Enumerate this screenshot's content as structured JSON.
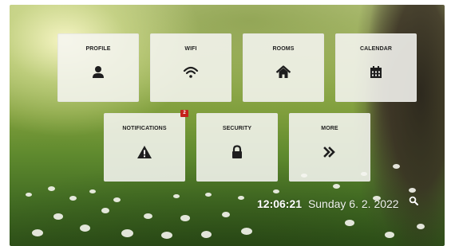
{
  "tiles": {
    "profile": {
      "label": "PROFILE",
      "icon": "user-icon"
    },
    "wifi": {
      "label": "WIFI",
      "icon": "wifi-icon"
    },
    "rooms": {
      "label": "ROOMS",
      "icon": "home-icon"
    },
    "calendar": {
      "label": "CALENDAR",
      "icon": "calendar-icon"
    },
    "notifications": {
      "label": "NOTIFICATIONS",
      "icon": "warning-icon",
      "badge_count": "2"
    },
    "security": {
      "label": "SECURITY",
      "icon": "lock-icon"
    },
    "more": {
      "label": "MORE",
      "icon": "double-chevron-right-icon"
    }
  },
  "status": {
    "time": "12:06:21",
    "date": "Sunday 6. 2. 2022"
  },
  "colors": {
    "tile_background": "#f5f5f0",
    "icon": "#1e1e1e",
    "badge": "#c4221b",
    "clock_text": "#ffffff"
  },
  "search": {
    "icon": "search-icon"
  }
}
